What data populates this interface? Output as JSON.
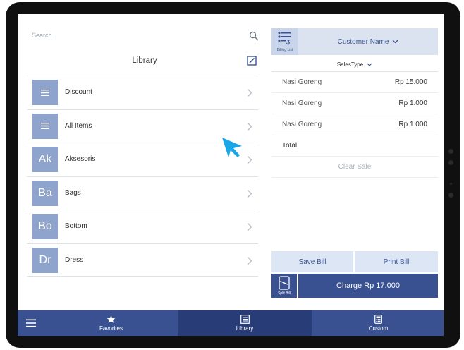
{
  "search": {
    "placeholder": "Search"
  },
  "library": {
    "title": "Library",
    "items": [
      {
        "tile": "",
        "tile_icon": "menu-lines-icon",
        "label": "Discount"
      },
      {
        "tile": "",
        "tile_icon": "menu-lines-icon",
        "label": "All Items"
      },
      {
        "tile": "Ak",
        "label": "Aksesoris"
      },
      {
        "tile": "Ba",
        "label": "Bags"
      },
      {
        "tile": "Bo",
        "label": "Bottom"
      },
      {
        "tile": "Dr",
        "label": "Dress"
      }
    ]
  },
  "bill": {
    "billing_list_label": "Billing List",
    "customer_label": "Customer Name",
    "sales_type_label": "SalesType",
    "items": [
      {
        "name": "Nasi Goreng",
        "price": "Rp 15.000"
      },
      {
        "name": "Nasi Goreng",
        "price": "Rp 1.000"
      },
      {
        "name": "Nasi Goreng",
        "price": "Rp 1.000"
      }
    ],
    "total_label": "Total",
    "clear_sale_label": "Clear Sale",
    "save_bill_label": "Save Bill",
    "print_bill_label": "Print Bill",
    "split_bill_label": "Split Bill",
    "charge_label": "Charge Rp 17.000"
  },
  "nav": {
    "favorites_label": "Favorites",
    "library_label": "Library",
    "custom_label": "Custom"
  },
  "colors": {
    "primary": "#3a5191",
    "primary_dark": "#283d78",
    "tile": "#8fa4cc",
    "light_accent": "#dde6f4"
  }
}
